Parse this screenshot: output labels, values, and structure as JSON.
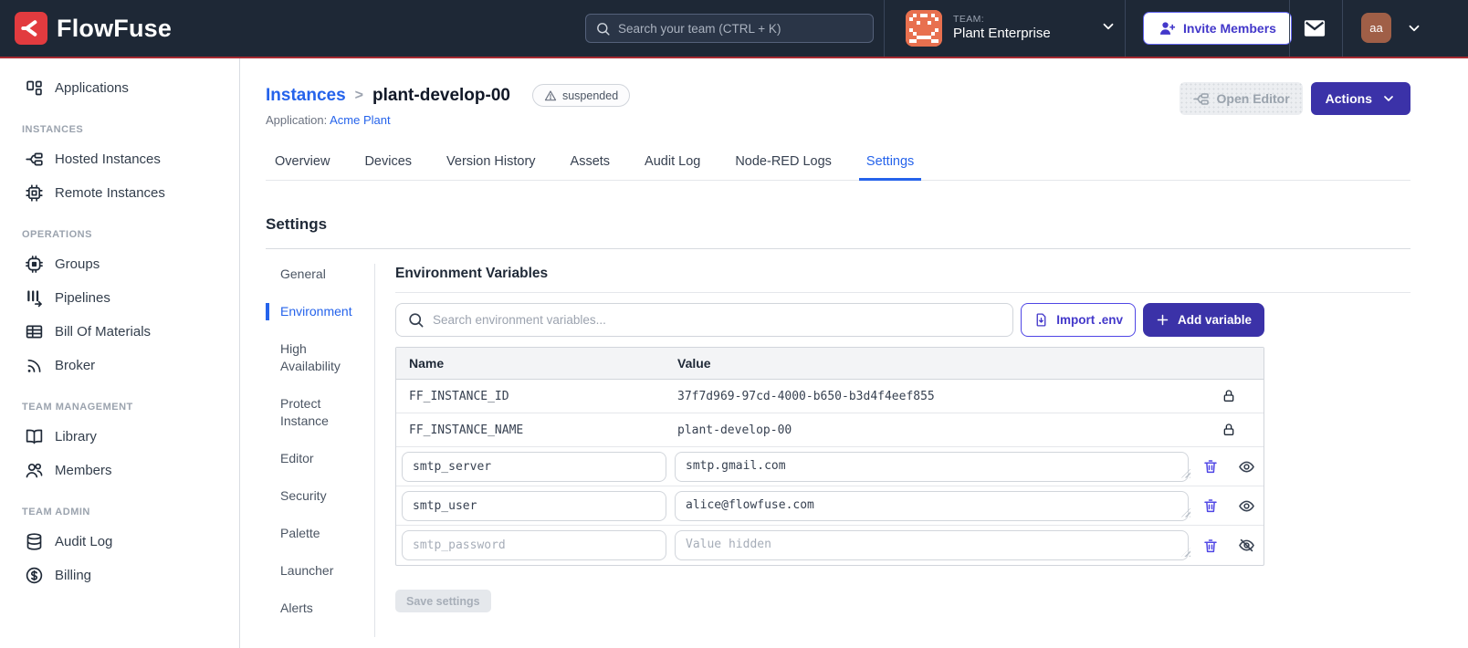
{
  "navbar": {
    "brand": "FlowFuse",
    "search_placeholder": "Search your team (CTRL + K)",
    "team_label": "TEAM:",
    "team_name": "Plant Enterprise",
    "invite_label": "Invite Members",
    "avatar_initials": "aa"
  },
  "sidebar": {
    "headers": {
      "h1": "INSTANCES",
      "h2": "OPERATIONS",
      "h3": "TEAM MANAGEMENT",
      "h4": "TEAM ADMIN"
    },
    "items": [
      {
        "label": "Applications",
        "icon": "applications-icon"
      },
      {
        "label": "Hosted Instances",
        "icon": "hosted-instances-icon"
      },
      {
        "label": "Remote Instances",
        "icon": "remote-instances-icon"
      },
      {
        "label": "Groups",
        "icon": "groups-icon"
      },
      {
        "label": "Pipelines",
        "icon": "pipelines-icon"
      },
      {
        "label": "Bill Of Materials",
        "icon": "bill-of-materials-icon"
      },
      {
        "label": "Broker",
        "icon": "broker-icon"
      },
      {
        "label": "Library",
        "icon": "library-icon"
      },
      {
        "label": "Members",
        "icon": "members-icon"
      },
      {
        "label": "Audit Log",
        "icon": "audit-log-icon"
      },
      {
        "label": "Billing",
        "icon": "billing-icon"
      }
    ]
  },
  "header": {
    "breadcrumb_parent": "Instances",
    "breadcrumb_separator": ">",
    "instance_name": "plant-develop-00",
    "status_badge": "suspended",
    "application_label": "Application:",
    "application_name": "Acme Plant",
    "open_editor_label": "Open Editor",
    "actions_label": "Actions"
  },
  "tabs": {
    "items": [
      {
        "label": "Overview"
      },
      {
        "label": "Devices"
      },
      {
        "label": "Version History"
      },
      {
        "label": "Assets"
      },
      {
        "label": "Audit Log"
      },
      {
        "label": "Node-RED Logs"
      },
      {
        "label": "Settings",
        "active": true
      }
    ]
  },
  "settings": {
    "title": "Settings",
    "active_nav": "Environment",
    "nav": [
      {
        "label": "General"
      },
      {
        "label": "Environment"
      },
      {
        "label": "High Availability"
      },
      {
        "label": "Protect Instance"
      },
      {
        "label": "Editor"
      },
      {
        "label": "Security"
      },
      {
        "label": "Palette"
      },
      {
        "label": "Launcher"
      },
      {
        "label": "Alerts"
      }
    ]
  },
  "env_panel": {
    "title": "Environment Variables",
    "search_placeholder": "Search environment variables...",
    "import_label": "Import .env",
    "add_label": "Add variable",
    "save_label": "Save settings",
    "table": {
      "columns": {
        "name": "Name",
        "value": "Value"
      },
      "locked_rows": [
        {
          "name": "FF_INSTANCE_ID",
          "value": "37f7d969-97cd-4000-b650-b3d4f4eef855"
        },
        {
          "name": "FF_INSTANCE_NAME",
          "value": "plant-develop-00"
        }
      ],
      "editable_rows": [
        {
          "name": "smtp_server",
          "value": "smtp.gmail.com",
          "hidden": false
        },
        {
          "name": "smtp_user",
          "value": "alice@flowfuse.com",
          "hidden": false
        },
        {
          "name": "smtp_password",
          "value": "",
          "value_placeholder": "Value hidden",
          "hidden": true
        }
      ]
    }
  },
  "colors": {
    "navbar_bg": "#1e2836",
    "navbar_accent_line": "#a82a32",
    "brand_red": "#e23b3f",
    "team_icon_orange": "#e8704f",
    "avatar_brown": "#a05f47",
    "indigo_button": "#3b32a8",
    "indigo_icon": "#4f46e5",
    "link_blue": "#2563eb",
    "text_dark": "#1f2937",
    "border_gray": "#d1d5db",
    "table_header_bg": "#f3f4f6"
  }
}
